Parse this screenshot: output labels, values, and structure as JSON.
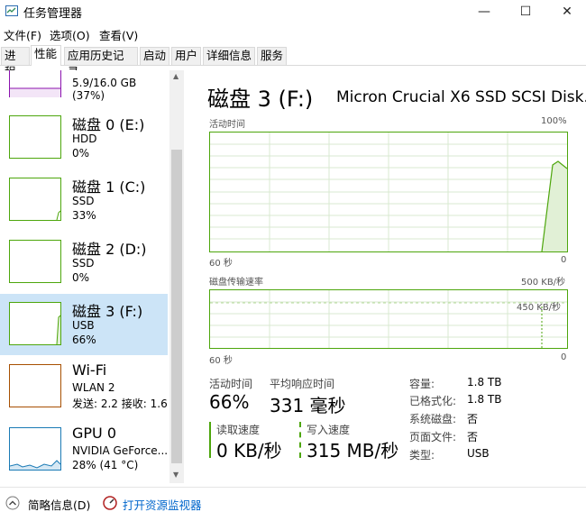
{
  "window": {
    "title": "任务管理器",
    "buttons": {
      "minimize": "—",
      "maximize": "☐",
      "close": "✕"
    }
  },
  "menu": [
    "文件(F)",
    "选项(O)",
    "查看(V)"
  ],
  "tabs": [
    "进程",
    "性能",
    "应用历史记录",
    "启动",
    "用户",
    "详细信息",
    "服务"
  ],
  "active_tab": "性能",
  "sidebar": {
    "memory_partial": "5.9/16.0 GB (37%)",
    "items": [
      {
        "title": "磁盘 0 (E:)",
        "line1": "HDD",
        "line2": "0%",
        "color": "#4da60c"
      },
      {
        "title": "磁盘 1 (C:)",
        "line1": "SSD",
        "line2": "33%",
        "color": "#4da60c"
      },
      {
        "title": "磁盘 2 (D:)",
        "line1": "SSD",
        "line2": "0%",
        "color": "#4da60c"
      },
      {
        "title": "磁盘 3 (F:)",
        "line1": "USB",
        "line2": "66%",
        "color": "#4da60c"
      },
      {
        "title": "Wi-Fi",
        "line1": "WLAN 2",
        "line2": "发送: 2.2  接收: 1.6",
        "color": "#a74f01"
      },
      {
        "title": "GPU 0",
        "line1": "NVIDIA GeForce...",
        "line2": "28% (41 °C)",
        "color": "#1a7ab5"
      }
    ],
    "selected_index": 3
  },
  "main": {
    "title": "磁盘 3 (F:)",
    "model": "Micron Crucial X6 SSD SCSI Disk...",
    "graph1": {
      "label": "活动时间",
      "max": "100%",
      "x_left": "60 秒",
      "x_right": "0",
      "current_percent": 66
    },
    "graph2": {
      "label": "磁盘传输速率",
      "max": "500 KB/秒",
      "marker": "450 KB/秒",
      "x_left": "60 秒",
      "x_right": "0"
    },
    "stats": {
      "active_time_label": "活动时间",
      "active_time": "66%",
      "response_label": "平均响应时间",
      "response": "331 毫秒",
      "read_label": "读取速度",
      "read": "0 KB/秒",
      "write_label": "写入速度",
      "write": "315 MB/秒"
    },
    "props": [
      {
        "k": "容量:",
        "v": "1.8 TB"
      },
      {
        "k": "已格式化:",
        "v": "1.8 TB"
      },
      {
        "k": "系统磁盘:",
        "v": "否"
      },
      {
        "k": "页面文件:",
        "v": "否"
      },
      {
        "k": "类型:",
        "v": "USB"
      }
    ]
  },
  "footer": {
    "summary": "简略信息(D)",
    "resmon": "打开资源监视器"
  },
  "colors": {
    "disk": "#4da60c",
    "selected": "#cce4f7",
    "link": "#0066cc"
  }
}
